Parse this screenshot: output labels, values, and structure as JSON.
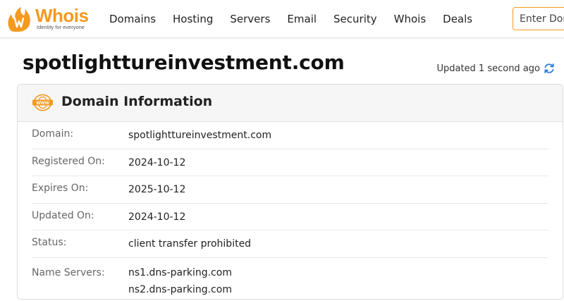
{
  "header": {
    "logo": {
      "name": "Whois",
      "tagline": "Identity for everyone",
      "icon": "whois-flame-logo-icon"
    },
    "nav": [
      "Domains",
      "Hosting",
      "Servers",
      "Email",
      "Security",
      "Whois",
      "Deals"
    ],
    "search": {
      "placeholder": "Enter Domain",
      "value": ""
    }
  },
  "page": {
    "title": "spotlighttureinvestment.com",
    "updated_text": "Updated 1 second ago",
    "refresh_icon": "refresh-icon"
  },
  "domain_info": {
    "title": "Domain Information",
    "icon": "www-icon",
    "rows": [
      {
        "label": "Domain:",
        "value": "spotlighttureinvestment.com"
      },
      {
        "label": "Registered On:",
        "value": "2024-10-12"
      },
      {
        "label": "Expires On:",
        "value": "2025-10-12"
      },
      {
        "label": "Updated On:",
        "value": "2024-10-12"
      },
      {
        "label": "Status:",
        "value": "client transfer prohibited"
      }
    ],
    "name_servers": {
      "label": "Name Servers:",
      "values": [
        "ns1.dns-parking.com",
        "ns2.dns-parking.com"
      ]
    }
  },
  "colors": {
    "brand": "#f39a1f",
    "refresh": "#2b7bd8"
  }
}
